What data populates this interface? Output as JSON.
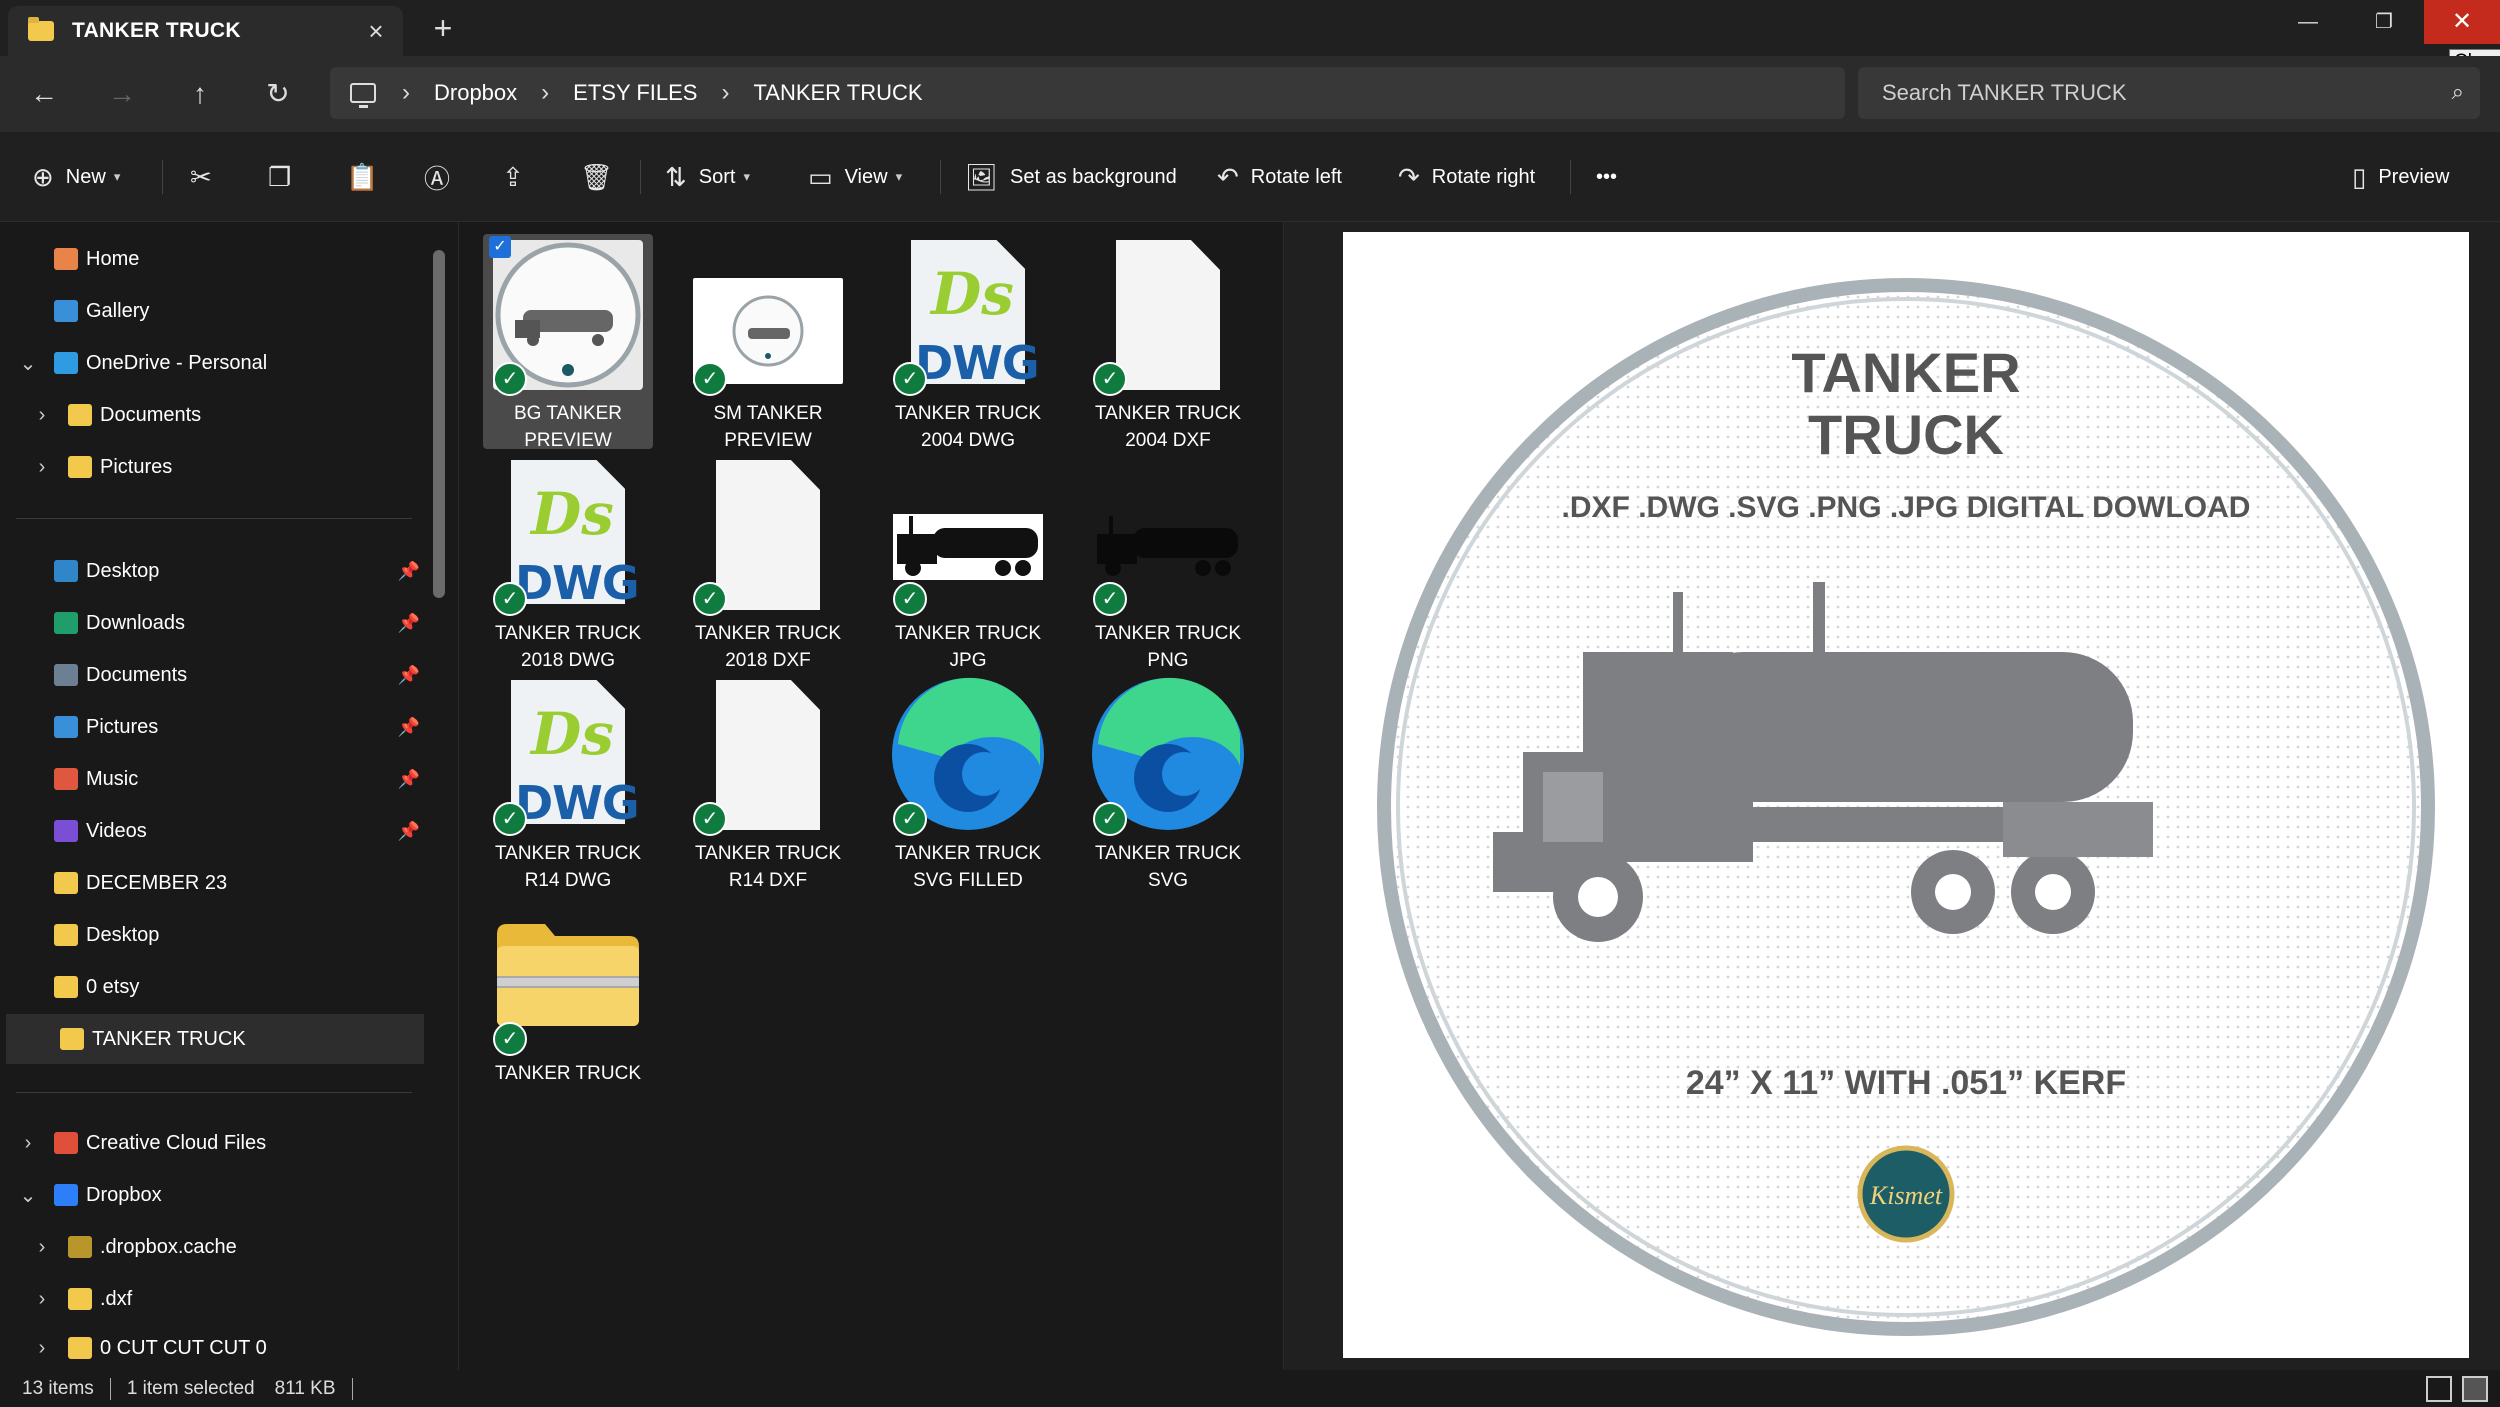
{
  "tab": {
    "title": "TANKER TRUCK",
    "close": "×",
    "new_tab": "+"
  },
  "window": {
    "minimize": "—",
    "maximize": "❐",
    "close": "✕",
    "tooltip": "Close"
  },
  "nav": {
    "breadcrumbs": [
      "Dropbox",
      "ETSY FILES",
      "TANKER TRUCK"
    ],
    "search_placeholder": "Search TANKER TRUCK"
  },
  "commands": {
    "new": "New",
    "sort": "Sort",
    "view": "View",
    "set_background": "Set as background",
    "rotate_left": "Rotate left",
    "rotate_right": "Rotate right",
    "more": "•••",
    "preview": "Preview"
  },
  "sidebar": {
    "top": [
      {
        "label": "Home",
        "icon": "home-icon",
        "color": "#e8834a"
      },
      {
        "label": "Gallery",
        "icon": "gallery-icon",
        "color": "#3a8fd9"
      },
      {
        "label": "OneDrive - Personal",
        "icon": "cloud-icon",
        "color": "#2f9be0"
      },
      {
        "label": "Documents",
        "icon": "folder-icon",
        "color": "#f2c94c"
      },
      {
        "label": "Pictures",
        "icon": "folder-icon",
        "color": "#f2c94c"
      }
    ],
    "quick": [
      {
        "label": "Desktop",
        "icon": "desktop-icon",
        "color": "#2f86c9",
        "pinned": true
      },
      {
        "label": "Downloads",
        "icon": "downloads-icon",
        "color": "#1f9d6b",
        "pinned": true
      },
      {
        "label": "Documents",
        "icon": "documents-icon",
        "color": "#6d7f93",
        "pinned": true
      },
      {
        "label": "Pictures",
        "icon": "pictures-icon",
        "color": "#3a8fd9",
        "pinned": true
      },
      {
        "label": "Music",
        "icon": "music-icon",
        "color": "#e0573f",
        "pinned": true
      },
      {
        "label": "Videos",
        "icon": "videos-icon",
        "color": "#7a4fd6",
        "pinned": true
      },
      {
        "label": "DECEMBER 23",
        "icon": "folder-icon",
        "color": "#f2c94c",
        "pinned": false
      },
      {
        "label": "Desktop",
        "icon": "folder-icon",
        "color": "#f2c94c",
        "pinned": false
      },
      {
        "label": "0 etsy",
        "icon": "folder-icon",
        "color": "#f2c94c",
        "pinned": false
      },
      {
        "label": "TANKER TRUCK",
        "icon": "folder-icon",
        "color": "#f2c94c",
        "pinned": false
      }
    ],
    "bottom": [
      {
        "label": "Creative Cloud Files",
        "icon": "creative-cloud-icon",
        "color": "#e04f3a"
      },
      {
        "label": "Dropbox",
        "icon": "dropbox-icon",
        "color": "#2d7ff9"
      },
      {
        "label": ".dropbox.cache",
        "icon": "folder-icon",
        "color": "#b8962c"
      },
      {
        "label": ".dxf",
        "icon": "folder-icon",
        "color": "#f2c94c"
      },
      {
        "label": "0 CUT CUT CUT 0",
        "icon": "folder-icon",
        "color": "#f2c94c"
      }
    ]
  },
  "files": [
    {
      "line1": "BG TANKER",
      "line2": "PREVIEW",
      "kind": "preview-big"
    },
    {
      "line1": "SM TANKER",
      "line2": "PREVIEW",
      "kind": "preview-small"
    },
    {
      "line1": "TANKER TRUCK",
      "line2": "2004 DWG",
      "kind": "dwg"
    },
    {
      "line1": "TANKER TRUCK",
      "line2": "2004 DXF",
      "kind": "doc"
    },
    {
      "line1": "TANKER TRUCK",
      "line2": "2018 DWG",
      "kind": "dwg"
    },
    {
      "line1": "TANKER TRUCK",
      "line2": "2018 DXF",
      "kind": "doc"
    },
    {
      "line1": "TANKER TRUCK",
      "line2": "JPG",
      "kind": "jpg"
    },
    {
      "line1": "TANKER TRUCK",
      "line2": "PNG",
      "kind": "png"
    },
    {
      "line1": "TANKER TRUCK",
      "line2": "R14 DWG",
      "kind": "dwg"
    },
    {
      "line1": "TANKER TRUCK",
      "line2": "R14 DXF",
      "kind": "doc"
    },
    {
      "line1": "TANKER TRUCK",
      "line2": "SVG FILLED",
      "kind": "edge"
    },
    {
      "line1": "TANKER TRUCK",
      "line2": "SVG",
      "kind": "edge"
    },
    {
      "line1": "TANKER TRUCK",
      "line2": "",
      "kind": "zip"
    }
  ],
  "dwg_label": {
    "ds": "Ds",
    "dwg": "DWG"
  },
  "preview": {
    "title1": "TANKER",
    "title2": "TRUCK",
    "formats": ".DXF .DWG .SVG .PNG .JPG DIGITAL DOWLOAD",
    "size": "24” X 11” WITH .051” KERF",
    "logo": "Kismet"
  },
  "status": {
    "count": "13 items",
    "selected": "1 item selected",
    "size": "811 KB"
  }
}
